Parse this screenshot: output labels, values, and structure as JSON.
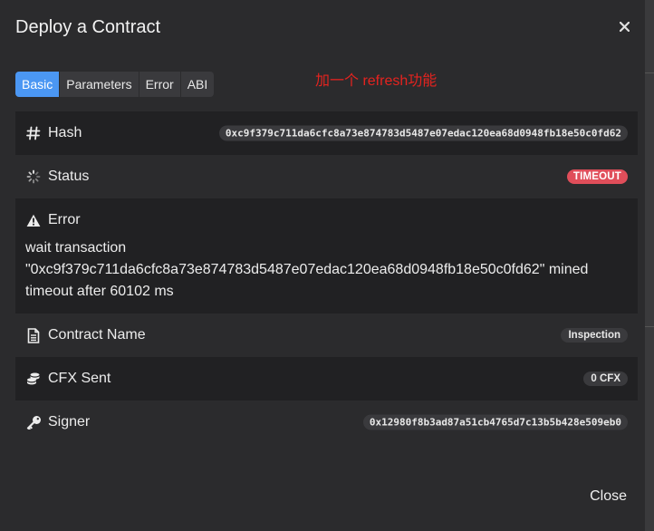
{
  "modal": {
    "title": "Deploy a Contract",
    "close_button": "Close"
  },
  "tabs": [
    {
      "label": "Basic",
      "active": true
    },
    {
      "label": "Parameters",
      "active": false
    },
    {
      "label": "Error",
      "active": false
    },
    {
      "label": "ABI",
      "active": false
    }
  ],
  "annotation": "加一个 refresh功能",
  "rows": {
    "hash": {
      "label": "Hash",
      "value": "0xc9f379c711da6cfc8a73e874783d5487e07edac120ea68d0948fb18e50c0fd62",
      "icon": "hash-icon"
    },
    "status": {
      "label": "Status",
      "value": "TIMEOUT",
      "icon": "spinner-icon"
    },
    "error": {
      "label": "Error",
      "message": "wait transaction\n\"0xc9f379c711da6cfc8a73e874783d5487e07edac120ea68d0948fb18e50c0fd62\" mined\ntimeout after 60102 ms",
      "icon": "warning-icon"
    },
    "contract_name": {
      "label": "Contract Name",
      "value": "Inspection",
      "icon": "document-icon"
    },
    "cfx_sent": {
      "label": "CFX Sent",
      "value": "0 CFX",
      "icon": "coins-icon"
    },
    "signer": {
      "label": "Signer",
      "value": "0x12980f8b3ad87a51cb4765d7c13b5b428e509eb0",
      "icon": "key-icon"
    }
  },
  "colors": {
    "accent": "#4b97f3",
    "timeout_badge": "#e04e5a",
    "annotation": "#e5231f",
    "modal_bg": "#2b2b2d",
    "row_dark_bg": "#212123"
  }
}
